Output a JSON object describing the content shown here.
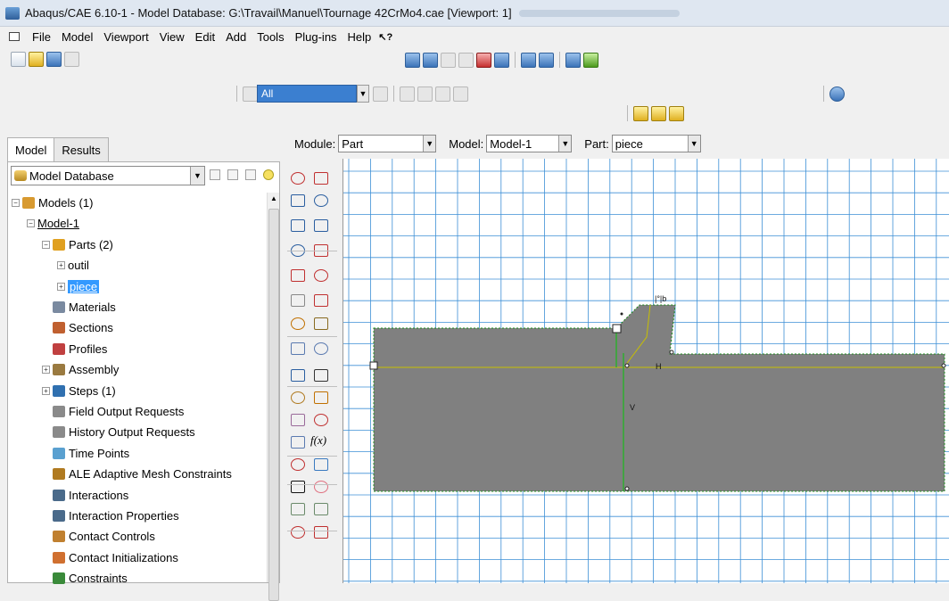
{
  "window": {
    "title": "Abaqus/CAE 6.10-1 - Model Database: G:\\Travail\\Manuel\\Tournage 42CrMo4.cae [Viewport: 1]"
  },
  "menu": [
    "File",
    "Model",
    "Viewport",
    "View",
    "Edit",
    "Add",
    "Tools",
    "Plug-ins",
    "Help"
  ],
  "selection_filter": {
    "value": "All"
  },
  "tabs": [
    "Model",
    "Results"
  ],
  "database_combo": {
    "value": "Model Database"
  },
  "tree": [
    {
      "label": "Models (1)",
      "level": 0,
      "expander": "-"
    },
    {
      "label": "Model-1",
      "level": 1,
      "expander": "-"
    },
    {
      "label": "Parts (2)",
      "level": 2,
      "expander": "-"
    },
    {
      "label": "outil",
      "level": 3,
      "expander": "+"
    },
    {
      "label": "piece",
      "level": 3,
      "expander": "+"
    },
    {
      "label": "Materials",
      "level": 2,
      "expander": ""
    },
    {
      "label": "Sections",
      "level": 2,
      "expander": ""
    },
    {
      "label": "Profiles",
      "level": 2,
      "expander": ""
    },
    {
      "label": "Assembly",
      "level": 2,
      "expander": "+"
    },
    {
      "label": "Steps (1)",
      "level": 2,
      "expander": "+"
    },
    {
      "label": "Field Output Requests",
      "level": 2,
      "expander": ""
    },
    {
      "label": "History Output Requests",
      "level": 2,
      "expander": ""
    },
    {
      "label": "Time Points",
      "level": 2,
      "expander": ""
    },
    {
      "label": "ALE Adaptive Mesh Constraints",
      "level": 2,
      "expander": ""
    },
    {
      "label": "Interactions",
      "level": 2,
      "expander": ""
    },
    {
      "label": "Interaction Properties",
      "level": 2,
      "expander": ""
    },
    {
      "label": "Contact Controls",
      "level": 2,
      "expander": ""
    },
    {
      "label": "Contact Initializations",
      "level": 2,
      "expander": ""
    },
    {
      "label": "Constraints",
      "level": 2,
      "expander": ""
    }
  ],
  "context_bar": {
    "module_label": "Module:",
    "module_value": "Part",
    "model_label": "Model:",
    "model_value": "Model-1",
    "part_label": "Part:",
    "part_value": "piece"
  },
  "sketch": {
    "labels": {
      "h": "H",
      "v": "V"
    },
    "colors": {
      "fill": "#808080",
      "grid": "#3d8fd6",
      "constraint": "#c8c000",
      "edge": "#1a8a1a"
    }
  },
  "tool_text": {
    "fx": "f(x)"
  }
}
